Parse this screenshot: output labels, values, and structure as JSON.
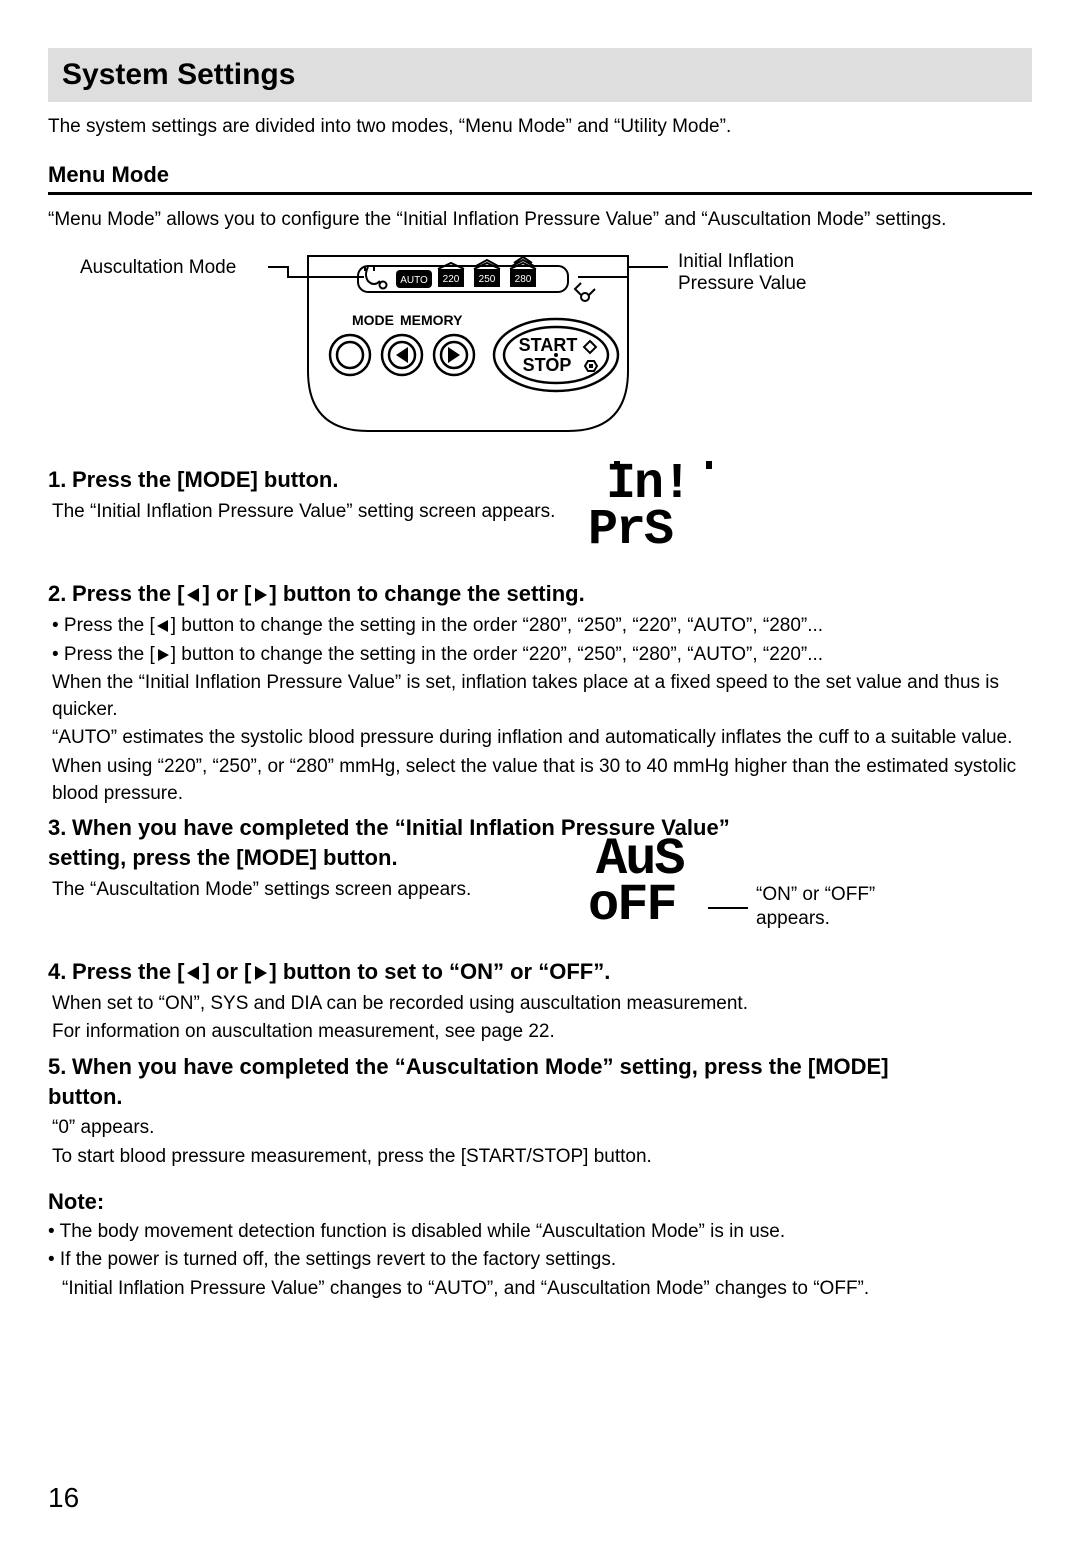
{
  "title": "System Settings",
  "intro": "The system settings are divided into two modes, “Menu Mode” and “Utility Mode”.",
  "menu_mode": {
    "heading": "Menu Mode",
    "desc": "“Menu Mode” allows you to configure the “Initial Inflation Pressure Value” and “Auscultation Mode” settings.",
    "label_left": "Auscultation Mode",
    "label_right_line1": "Initial Inflation",
    "label_right_line2": "Pressure Value"
  },
  "device": {
    "pressure_options": [
      "AUTO",
      "220",
      "250",
      "280"
    ],
    "button_mode": "MODE",
    "button_memory": "MEMORY",
    "button_start": "START",
    "button_stop": "STOP"
  },
  "steps": {
    "s1": {
      "n": "1.",
      "head": "Press the [MODE] button.",
      "body": "The “Initial Inflation Pressure Value” setting screen appears.",
      "lcd1": "In!",
      "lcd2": "PrS"
    },
    "s2": {
      "n": "2.",
      "head_pre": "Press the [",
      "head_mid": "] or [",
      "head_post": "] button to change the setting.",
      "b1_pre": "• Press the [",
      "b1_post": "] button to change the setting in the order “280”, “250”, “220”, “AUTO”, “280”...",
      "b2_pre": "• Press the [",
      "b2_post": "] button to change the setting in the order “220”, “250”, “280”, “AUTO”, “220”...",
      "p1": "When the “Initial Inflation Pressure Value” is set, inflation takes place at a fixed speed to the set value and thus is quicker.",
      "p2": "“AUTO” estimates the systolic blood pressure during inflation and automatically inflates the cuff to a suitable value.",
      "p3": "When using “220”, “250”, or “280” mmHg, select the value that is 30 to 40 mmHg higher than the estimated systolic blood pressure."
    },
    "s3": {
      "n": "3.",
      "head": "When you have completed the “Initial Inflation Pressure Value” setting, press the [MODE] button.",
      "body": "The “Auscultation Mode” settings screen appears.",
      "lcd1": "AuS",
      "lcd2": "oFF",
      "caption_l1": "“ON” or “OFF”",
      "caption_l2": "appears."
    },
    "s4": {
      "n": "4.",
      "head_pre": "Press the [",
      "head_mid": "] or [",
      "head_post": "] button to set to “ON” or “OFF”.",
      "p1": "When set to “ON”, SYS and DIA can be recorded using auscultation measurement.",
      "p2": "For information on auscultation measurement, see page 22."
    },
    "s5": {
      "n": "5.",
      "head": "When you have completed the “Auscultation Mode” setting, press the [MODE] button.",
      "p1": "“0” appears.",
      "p2": "To start blood pressure measurement, press the [START/STOP] button."
    }
  },
  "note": {
    "heading": "Note:",
    "p1": "• The body movement detection function is disabled while “Auscultation Mode” is in use.",
    "p2": "• If the power is turned off, the settings revert to the factory settings.",
    "p3": "“Initial Inflation Pressure Value” changes to “AUTO”, and “Auscultation Mode” changes to “OFF”."
  },
  "page_number": "16"
}
